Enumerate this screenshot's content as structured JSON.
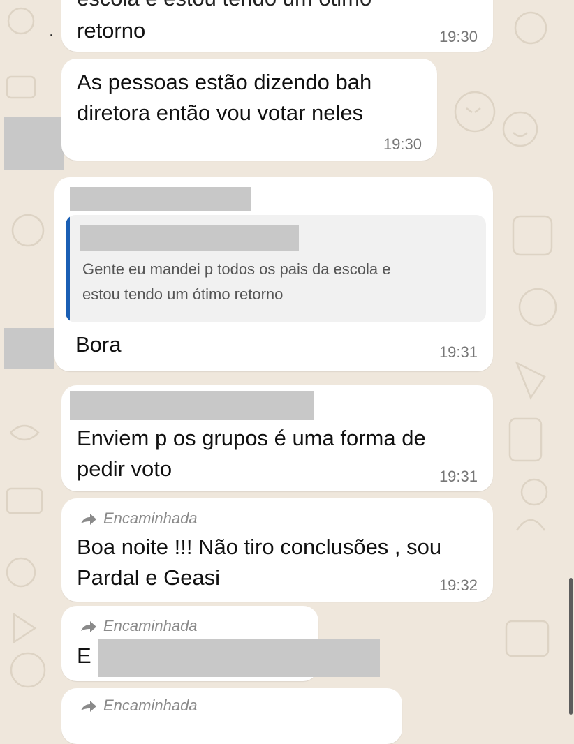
{
  "chat": {
    "forwarded_label": "Encaminhada",
    "messages": [
      {
        "text": "retorno",
        "time": "19:30",
        "partial_top": "escola e estou tendo um ótimo"
      },
      {
        "text": "As pessoas estão dizendo bah\ndiretora então vou votar neles",
        "time": "19:30"
      },
      {
        "quoted_text": "Gente eu mandei p todos os pais da escola e\nestou tendo um ótimo retorno",
        "text": "Bora",
        "time": "19:31"
      },
      {
        "text": "Enviem p os grupos é uma forma de\npedir voto",
        "time": "19:31"
      },
      {
        "forwarded": true,
        "text": "Boa noite !!! Não tiro conclusões , sou\nPardal e Geasi",
        "time": "19:32"
      },
      {
        "forwarded": true,
        "text": "E"
      },
      {
        "forwarded": true
      }
    ],
    "stray_mark": "."
  },
  "colors": {
    "quote_bar": "#1a5fb4",
    "redaction": "#c8c8c8",
    "background": "#efe7dc"
  }
}
